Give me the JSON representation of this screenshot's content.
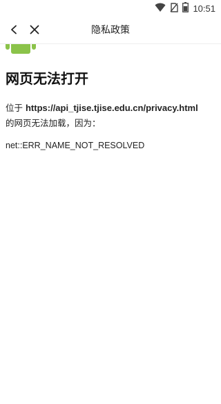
{
  "status_bar": {
    "time": "10:51",
    "icons": [
      "wifi-icon",
      "no-sim-icon",
      "battery-icon"
    ]
  },
  "app_bar": {
    "title": "隐私政策",
    "icons": [
      "back-arrow-icon",
      "close-icon"
    ]
  },
  "error_page": {
    "title": "网页无法打开",
    "desc_prefix": "位于 ",
    "url": "https://api_tjise.tjise.edu.cn/privacy.html",
    "desc_suffix": "的网页无法加载，因为：",
    "error_code": "net::ERR_NAME_NOT_RESOLVED",
    "image_icon": "android-robot-icon",
    "accent_color": "#8BC34A"
  }
}
